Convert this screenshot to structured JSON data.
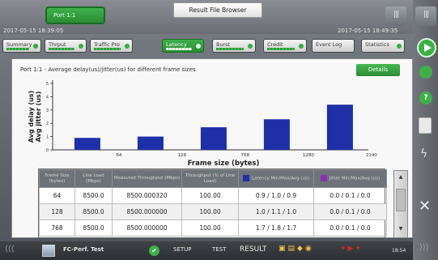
{
  "header": {
    "port_button": "Port 1:1",
    "title": "Result File Browser",
    "timestamp_left": "2017-05-15 18:39:05",
    "timestamp_right": "2017-05-15 18:49:35"
  },
  "tabs": [
    {
      "label": "Summary",
      "active": false
    },
    {
      "label": "Thrput",
      "active": false
    },
    {
      "label": "Traffic Pro",
      "active": false
    },
    {
      "label": "Latency",
      "active": true
    },
    {
      "label": "Burst",
      "active": false
    },
    {
      "label": "Credit",
      "active": false
    },
    {
      "label": "Event Log",
      "active": false
    },
    {
      "label": "Statistics",
      "active": false
    }
  ],
  "chart_title": "Port 1:1 - Average delay(us)/jitter(us) for different frame sizes",
  "details_label": "Details",
  "chart_data": {
    "type": "bar",
    "title": "Port 1:1 - Average delay(us)/jitter(us) for different frame sizes",
    "xlabel": "Frame size (bytes)",
    "ylabel": "Avg delay (us)\nAvg jitter (us)",
    "y_ticks": [
      "0",
      "1",
      "2",
      "3",
      "4",
      "5"
    ],
    "x_tick_labels": [
      "64",
      "128",
      "768",
      "1280",
      "2140"
    ],
    "categories": [
      "64",
      "128",
      "768",
      "1280",
      "2140"
    ],
    "values": [
      0.9,
      1.0,
      1.7,
      2.3,
      3.4
    ],
    "ylim": [
      0,
      5
    ],
    "bar_color": "#1f2fa8"
  },
  "table": {
    "headers": [
      "Frame Size (bytes)",
      "Line Load (Mbps)",
      "Measured Throughput (Mbps)",
      "Throughput (% of Line Load)",
      "Latency Min/Max/Avg (us)",
      "Jitter Min/Max/Avg (us)"
    ],
    "latency_color": "#1f2fa8",
    "jitter_color": "#8e2fb3",
    "rows": [
      [
        "64",
        "8500.0",
        "8500.000320",
        "100.00",
        "0.9 / 1.0 / 0.9",
        "0.0 / 0.1 / 0.0"
      ],
      [
        "128",
        "8500.0",
        "8500.000000",
        "100.00",
        "1.0 / 1.1 / 1.0",
        "0.0 / 0.1 / 0.0"
      ],
      [
        "768",
        "8500.0",
        "8500.000000",
        "100.00",
        "1.7 / 1.8 / 1.7",
        "0.0 / 0.1 / 0.0"
      ]
    ]
  },
  "bottom": {
    "app_name": "FC-Perf. Test",
    "setup": "SETUP",
    "test": "TEST",
    "result": "RESULT",
    "clock": "18:54"
  },
  "colors": {
    "accent_green": "#38ad42",
    "bar_blue": "#1f2fa8"
  }
}
